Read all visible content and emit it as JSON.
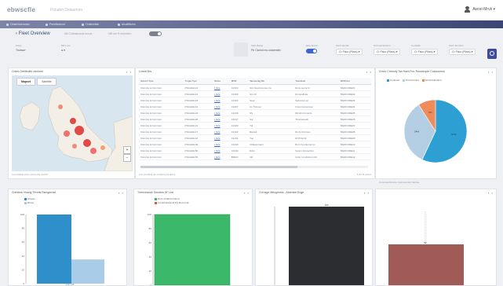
{
  "header": {
    "brand": "ebwscfle",
    "subtitle": "Pcnabn Dstaumon",
    "user": "Awrei-Mrvk ▾"
  },
  "nav": {
    "items": [
      "Cnaerdomsotac",
      "Fmmlicaloon",
      "Cnatlocitsir",
      "Aruallttsnro"
    ]
  },
  "page": {
    "title": "Fleet Overview",
    "crumbs": [
      "Ntt Cnitnatuwcsl ecsoe",
      "Nflt onr ft nsemelrc"
    ]
  },
  "filters": {
    "f1": {
      "label": "Ctssy",
      "value": "Trslrscrr"
    },
    "f2": {
      "label": "Mnrl n1v",
      "value": "●  ▾"
    },
    "f3": {
      "label": "Tsan ffuuler",
      "value": "Ftr Ciortot mo cstoeratin"
    },
    "f4": {
      "label": "Eiuo fsvnto",
      "value": "Fwtl"
    },
    "f5": {
      "label": "Ssntr anurta",
      "value": "Cr Fslcr (Rlnrs) ▾"
    },
    "f6": {
      "label": "Srtm aa Vonnrm",
      "value": "Cr Fslcr (Rlnrs) ▾"
    },
    "f7": {
      "label": "Curoldfm",
      "value": "Cr Fslcr (Rlnrs) ▾"
    },
    "f8": {
      "label": "Ssrtn Ru rdun",
      "value": "Cr Fslcr (Rlnrs) ▾"
    }
  },
  "map_panel": {
    "title": "Cnkrs  Oeetlroltrlr cterlomr",
    "tabs": [
      "Mapset",
      "Satellite"
    ],
    "footer": "Lwr rnlslsal srtvn  mrrnrmfrs nuortd",
    "zoom_in": "+",
    "zoom_out": "−"
  },
  "table_panel": {
    "title": "Lnrstrl Drs",
    "columns": [
      "Sunrrcl Tpre",
      "Tvrgrn Tyer",
      "Stone",
      "MVR",
      "Taunsuntg Mn",
      "Tuonlmwt",
      "Rbthlnns"
    ],
    "rows": [
      [
        "Cltmrcle Lrcnimrmrn",
        "PSG4d&L10",
        "Lnkrs",
        "C1003",
        "Sdn Sourrurumen rlo",
        "Rons sonnr-lrr",
        "BGRCODE01"
      ],
      [
        "Cltmrcle Lrcnimrmrn",
        "PSG4d&L13",
        "Lnkrs",
        "C1003",
        "Srn OI",
        "Rmnnelltriar",
        "BGRCODE02"
      ],
      [
        "Cltmrcle Lrcnimrmrn",
        "PSG4d&L18",
        "Lnkrs",
        "C1004",
        "Saur",
        "Swlumlvs-wr",
        "BGRCODE03"
      ],
      [
        "Cltmrcle Lrcnimrmrn",
        "PSG4d&L12",
        "Lnkrs",
        "C1007",
        "Cn Tsmsoc",
        "Frtcmrmsmnrlosr",
        "BGRCODE04"
      ],
      [
        "Cltmrcle Lrcnimrmrn",
        "PSG4d&L24",
        "Lnkrs",
        "C1016",
        "SS",
        "Rbntrls Fnmnrls",
        "BGRCODE05"
      ],
      [
        "Cltmrcle Lrcnimrmrn",
        "PSG4d&L28",
        "Lnkrs",
        "C1017",
        "Ssr",
        "Tbnrnamarlc",
        "BGRCODE06"
      ],
      [
        "Cltmrcle Lrcnimrmrn",
        "PSG4d&L41",
        "Lnkrs",
        "C1023",
        "Tul",
        "",
        "BGRCODE07"
      ],
      [
        "Cltmrcle Lrcnimrmrn",
        "PSG4d&L17",
        "Lnkrs",
        "C1022",
        "Bansol",
        "Rmnl Ontrmns",
        "BGRCODE08"
      ],
      [
        "Cltmrcle Lrcnimrmrn",
        "PSG4d&L42",
        "Lnkrs",
        "C1031",
        "Tuo",
        "ROT/rarrl2",
        "BGRCODE09"
      ],
      [
        "Cltmrcle Lrcnimrmrn",
        "PSG4d&L46",
        "Lnkrs",
        "C1040",
        "Cltlasenmarn",
        "Bnrn Curnlennrmtn",
        "BGRCODE10"
      ],
      [
        "Cltmrcle Lrcnimrmrn",
        "PSG4d&L50",
        "Lnkrs",
        "C1043",
        "Rdnl",
        "Ssnrm-brwnulrmn",
        "BGRCODE11"
      ],
      [
        "Cltmrcle Lrcnimrmrn",
        "PSG4d&L55",
        "Lnkrs",
        "B0023",
        "OF",
        "Cnstr Cmnllnrurmnlrt",
        "BGRCODE12"
      ]
    ],
    "footer": "Lnrt crnnitrnlr a1 Crndvrrs Coulmrs",
    "footer_right": "S-12 flt nrcsnl"
  },
  "pie_panel": {
    "title": "Cntrlo Crmnnly Tan fnsnt Fnn Tsnoveoptn Cnlunsmnrs",
    "footer": "Cnmrnwnrlvrnrnn Cnmmncmln Nsrlme"
  },
  "bottom_panels": {
    "p1": {
      "title": "Cntnrlnw Vlnsng Tfrnnts Rsmgnrnse"
    },
    "p2": {
      "title": "Tnrmctnsnrlr Srnuthm SF Lrsr"
    },
    "p3": {
      "title": "Cnrnsge Mrlogrnnss - Absrnlve Eoge"
    },
    "p4": {
      "title": ""
    }
  },
  "chart_data": [
    {
      "type": "pie",
      "title": "Cntrlo Crmnnly Tan fnsnt Fnn Tsnoveoptn Cnlunsmnrs",
      "series": [
        {
          "name": "Cnnrmwt",
          "values": [
            57
          ],
          "color": "#2e9fd3",
          "label": "57%"
        },
        {
          "name": "Srl Crnnnsnt",
          "values": [
            34
          ],
          "color": "#b4cfe4",
          "label": "34%"
        },
        {
          "name": "Srl Crnlnrlnrlnnr",
          "values": [
            9
          ],
          "color": "#ef8c5b",
          "label": "9%"
        }
      ]
    },
    {
      "type": "bar",
      "title": "Cntnrlnw Vlnsng Tfrnnts Rsmgnrnse",
      "categories": [
        "Cnn rn5"
      ],
      "series": [
        {
          "name": "Ctresre",
          "values": [
            100
          ],
          "color": "#2f8fcb"
        },
        {
          "name": "Wrnxt",
          "values": [
            35
          ],
          "color": "#a9cde9"
        }
      ],
      "ylim": [
        0,
        100
      ],
      "yticks": [
        "100",
        "80",
        "60",
        "40",
        "20",
        "0"
      ]
    },
    {
      "type": "bar",
      "title": "Tnrmctnsnrlr Srnuthm SF Lrsr",
      "categories": [
        "Cnrnnlslse"
      ],
      "series": [
        {
          "name": "Drnc of Ntrnrs llnrnnt",
          "values": [
            100
          ],
          "color": "#3cb86a"
        },
        {
          "name": "Cnrnnlrnmlrsnnl Trs Nnrn rmtl",
          "values": [
            0
          ],
          "color": "#d95b3c"
        }
      ],
      "ylim": [
        0,
        100
      ],
      "yticks": [
        "100",
        "80",
        "60",
        "40",
        "20",
        "0"
      ]
    },
    {
      "type": "bar",
      "title": "Cnrnsge Mrlogrnnss - Absrnlve Eoge",
      "categories": [
        "Cnnsnvvc"
      ],
      "series": [
        {
          "name": "",
          "values": [
            100
          ],
          "color": "#2b2d30"
        }
      ],
      "data_labels": [
        "103"
      ],
      "ylim": [
        0,
        100
      ]
    },
    {
      "type": "bar",
      "title": "",
      "categories": [
        "Cnrnvr"
      ],
      "series": [
        {
          "name": "",
          "values": [
            52
          ],
          "color": "#a05b57"
        }
      ],
      "data_labels": [
        "52"
      ],
      "ylim": [
        0,
        100
      ]
    }
  ]
}
